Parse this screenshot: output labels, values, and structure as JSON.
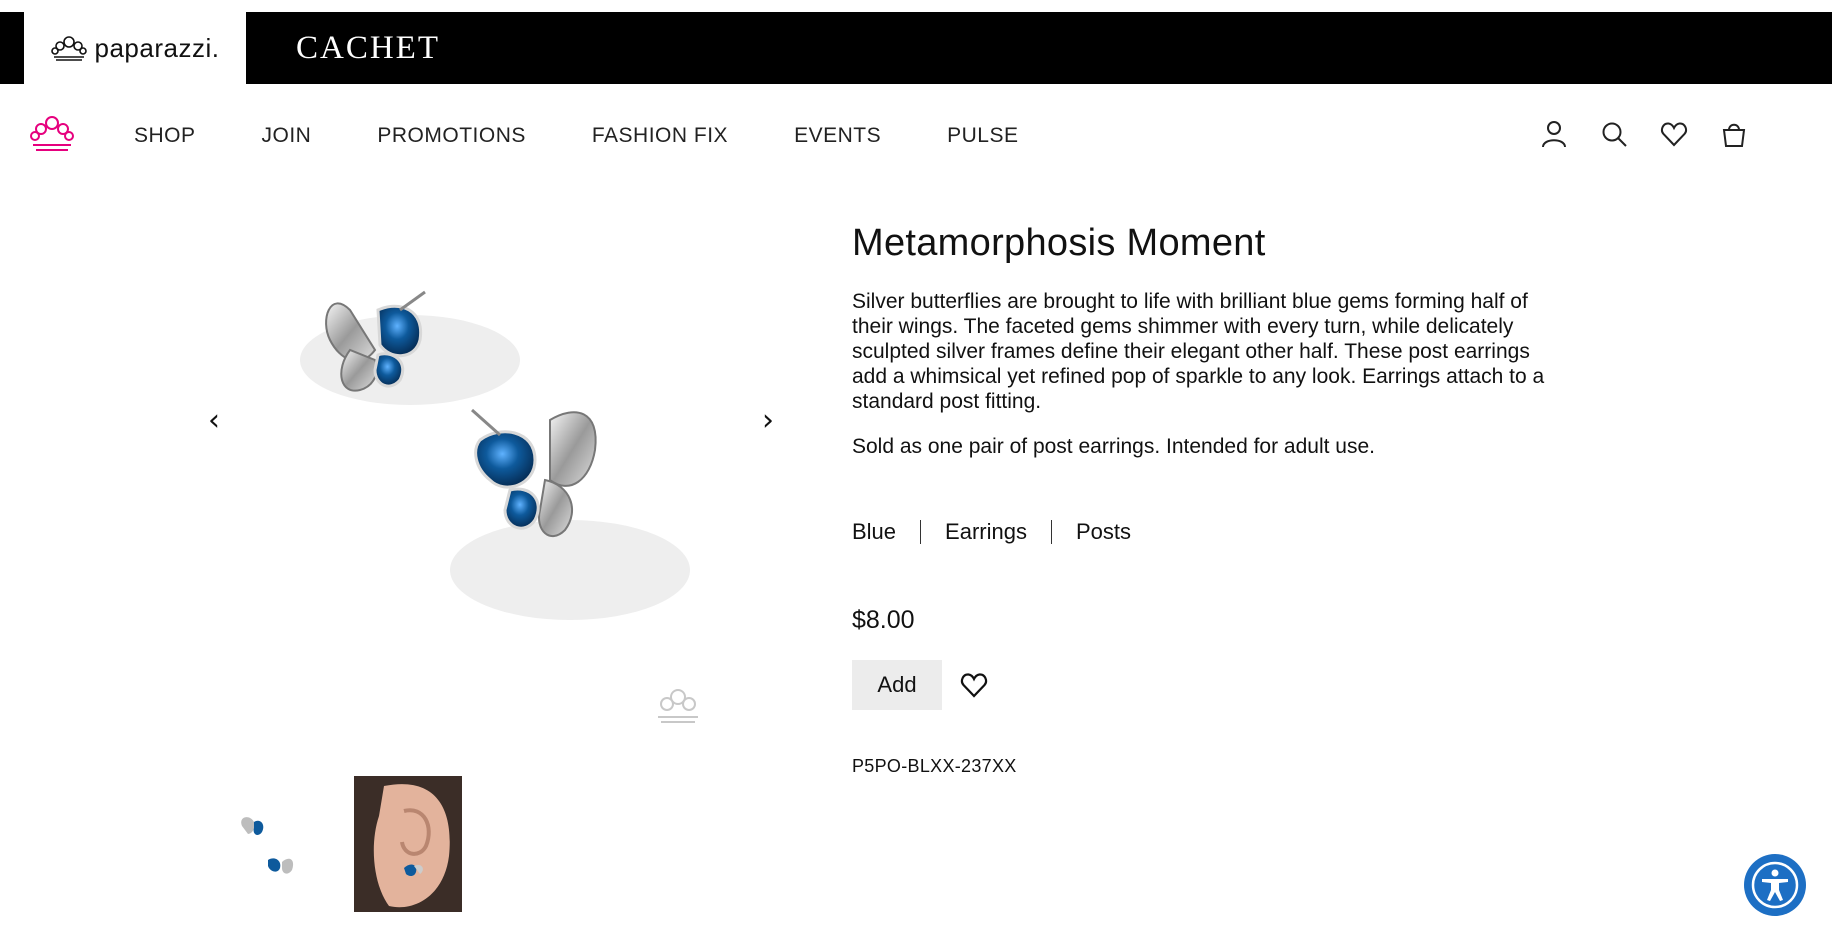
{
  "brands": {
    "active": "paparazzi.",
    "secondary": "CACHET"
  },
  "nav": {
    "links": [
      "SHOP",
      "JOIN",
      "PROMOTIONS",
      "FASHION FIX",
      "EVENTS",
      "PULSE"
    ],
    "icons": [
      "account-icon",
      "search-icon",
      "heart-icon",
      "bag-icon"
    ],
    "logo_color": "#e6007e"
  },
  "product": {
    "title": "Metamorphosis Moment",
    "description": "Silver butterflies are brought to life with brilliant blue gems forming half of their wings. The faceted gems shimmer with every turn, while delicately sculpted silver frames define their elegant other half. These post earrings add a whimsical yet refined pop of sparkle to any look. Earrings attach to a standard post fitting.",
    "sold_as": "Sold as one pair of post earrings. Intended for adult use.",
    "tags": [
      "Blue",
      "Earrings",
      "Posts"
    ],
    "price": "$8.00",
    "add_label": "Add",
    "sku": "P5PO-BLXX-237XX"
  },
  "gallery": {
    "prev_arrow": "‹",
    "next_arrow": "›",
    "thumbnails": [
      "thumbnail-product",
      "thumbnail-model"
    ]
  },
  "colors": {
    "gem_blue": "#0e5a9c",
    "accessibility_blue": "#1d6fc4",
    "logo_pink": "#e6007e"
  }
}
